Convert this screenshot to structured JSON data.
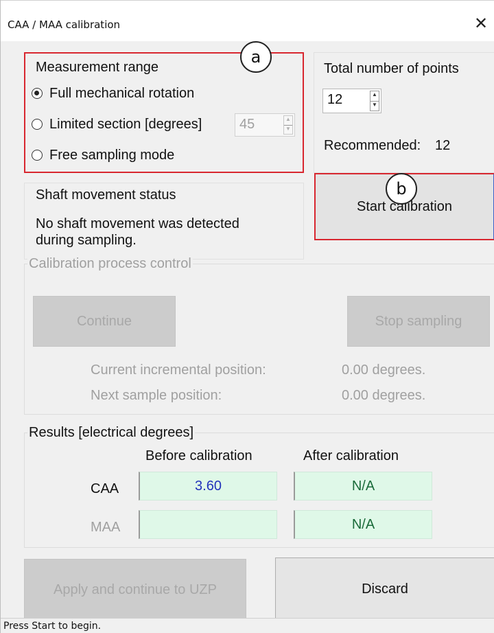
{
  "window": {
    "title": "CAA / MAA calibration",
    "close_glyph": "✕"
  },
  "measurement_range": {
    "heading": "Measurement range",
    "options": [
      {
        "label": "Full mechanical rotation",
        "selected": true
      },
      {
        "label": "Limited section [degrees]",
        "selected": false
      },
      {
        "label": "Free sampling mode",
        "selected": false
      }
    ],
    "limited_section_value": "45",
    "callout": "a"
  },
  "points": {
    "heading": "Total number of points",
    "value": "12",
    "recommended_label": "Recommended:",
    "recommended_value": "12"
  },
  "shaft_status": {
    "heading": "Shaft movement status",
    "message_line1": "No shaft movement was detected",
    "message_line2": "during sampling."
  },
  "start": {
    "label": "Start calibration",
    "callout": "b"
  },
  "process_control": {
    "heading": "Calibration process control",
    "continue_label": "Continue",
    "stop_label": "Stop sampling",
    "current_position_label": "Current incremental position:",
    "current_position_value": "0.00 degrees.",
    "next_position_label": "Next sample position:",
    "next_position_value": "0.00 degrees."
  },
  "results": {
    "heading": "Results [electrical degrees]",
    "col_before": "Before calibration",
    "col_after": "After calibration",
    "rows": [
      {
        "name": "CAA",
        "before": "3.60",
        "after": "N/A"
      },
      {
        "name": "MAA",
        "before": "",
        "after": "N/A"
      }
    ]
  },
  "footer": {
    "apply_label": "Apply and continue to UZP",
    "discard_label": "Discard"
  },
  "status": {
    "text": "Press Start to begin."
  },
  "colors": {
    "annotation_red": "#d8262f",
    "result_field_bg": "#dff8e8",
    "before_value_text": "#2233bb",
    "after_value_text": "#1a6b3a"
  },
  "icons": {
    "close": "close-icon",
    "spin_up": "chevron-up-icon",
    "spin_down": "chevron-down-icon"
  }
}
